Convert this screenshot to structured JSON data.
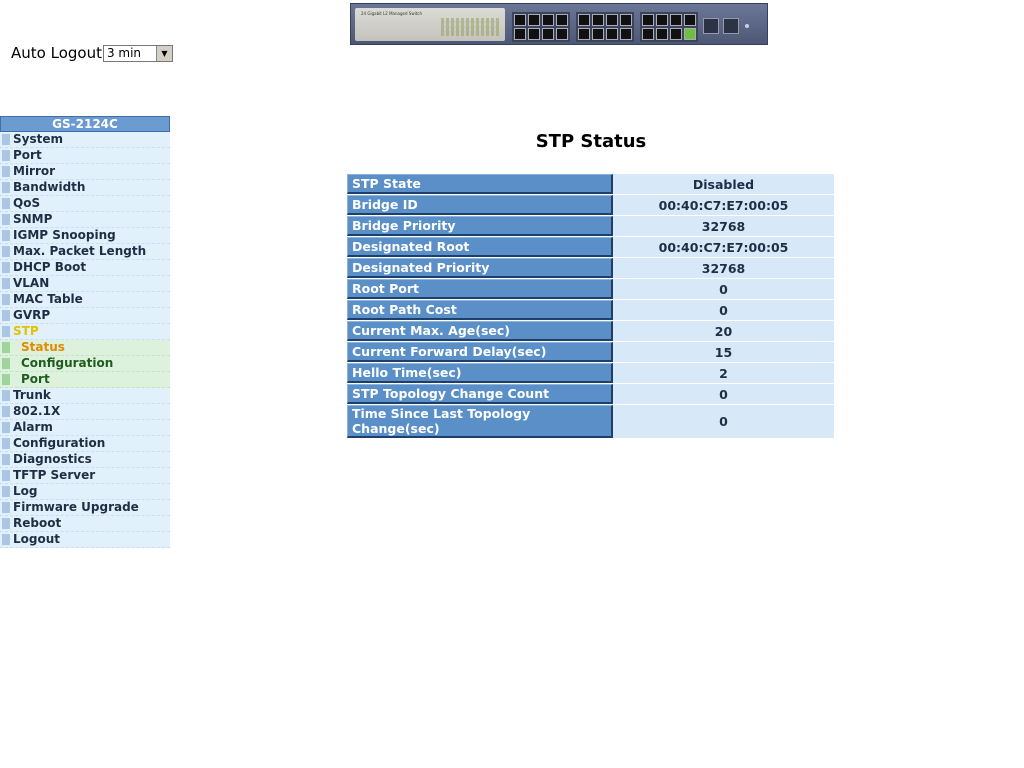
{
  "banner": {
    "model_text": "24 Gigabit L2 Managed Switch"
  },
  "auto_logout": {
    "label": "Auto Logout",
    "selected": "3 min"
  },
  "sidebar": {
    "title": "GS-2124C",
    "items": [
      {
        "label": "System"
      },
      {
        "label": "Port"
      },
      {
        "label": "Mirror"
      },
      {
        "label": "Bandwidth"
      },
      {
        "label": "QoS"
      },
      {
        "label": "SNMP"
      },
      {
        "label": "IGMP Snooping"
      },
      {
        "label": "Max. Packet Length"
      },
      {
        "label": "DHCP Boot"
      },
      {
        "label": "VLAN"
      },
      {
        "label": "MAC Table"
      },
      {
        "label": "GVRP"
      },
      {
        "label": "STP"
      }
    ],
    "stp_sub": [
      {
        "label": "Status"
      },
      {
        "label": "Configuration"
      },
      {
        "label": "Port"
      }
    ],
    "items_after": [
      {
        "label": "Trunk"
      },
      {
        "label": "802.1X"
      },
      {
        "label": "Alarm"
      },
      {
        "label": "Configuration"
      },
      {
        "label": "Diagnostics"
      },
      {
        "label": "TFTP Server"
      },
      {
        "label": "Log"
      },
      {
        "label": "Firmware Upgrade"
      },
      {
        "label": "Reboot"
      },
      {
        "label": "Logout"
      }
    ]
  },
  "main": {
    "title": "STP Status",
    "rows": [
      {
        "key": "STP State",
        "value": "Disabled"
      },
      {
        "key": "Bridge ID",
        "value": "00:40:C7:E7:00:05"
      },
      {
        "key": "Bridge Priority",
        "value": "32768"
      },
      {
        "key": "Designated Root",
        "value": "00:40:C7:E7:00:05"
      },
      {
        "key": "Designated Priority",
        "value": "32768"
      },
      {
        "key": "Root Port",
        "value": "0"
      },
      {
        "key": "Root Path Cost",
        "value": "0"
      },
      {
        "key": "Current Max. Age(sec)",
        "value": "20"
      },
      {
        "key": "Current Forward Delay(sec)",
        "value": "15"
      },
      {
        "key": "Hello Time(sec)",
        "value": "2"
      },
      {
        "key": "STP Topology Change Count",
        "value": "0"
      },
      {
        "key": "Time Since Last Topology Change(sec)",
        "value": "0"
      }
    ]
  },
  "colors": {
    "nav_header": "#6b9bd0",
    "nav_item_bg": "#e2f0fb",
    "nav_sub_bg": "#ddf1dc",
    "active_stp": "#e0c400",
    "active_status": "#e08a00",
    "table_key_bg": "#5a8fc8",
    "table_val_bg": "#d7e9f9"
  }
}
